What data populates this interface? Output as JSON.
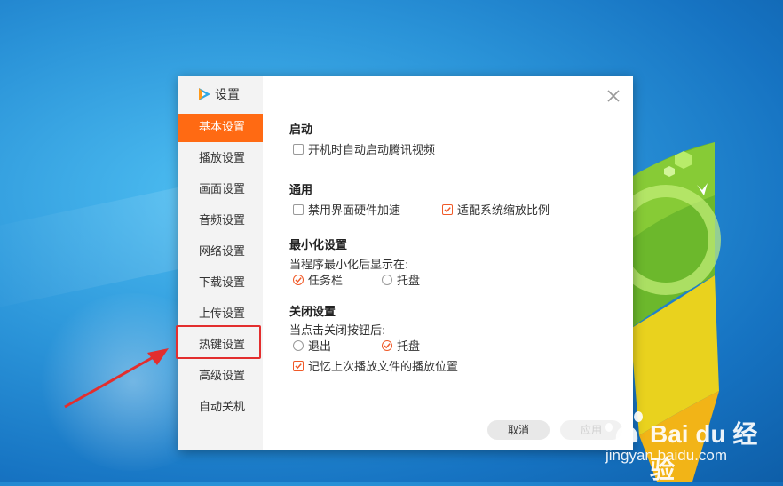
{
  "dialog": {
    "title": "设置",
    "nav": [
      {
        "label": "基本设置",
        "active": true
      },
      {
        "label": "播放设置"
      },
      {
        "label": "画面设置"
      },
      {
        "label": "音频设置"
      },
      {
        "label": "网络设置"
      },
      {
        "label": "下载设置"
      },
      {
        "label": "上传设置"
      },
      {
        "label": "热键设置"
      },
      {
        "label": "高级设置"
      },
      {
        "label": "自动关机"
      }
    ],
    "sections": {
      "startup": {
        "title": "启动",
        "autostart_label": "开机时自动启动腾讯视频",
        "autostart_checked": false
      },
      "general": {
        "title": "通用",
        "disable_hw_label": "禁用界面硬件加速",
        "disable_hw_checked": false,
        "adapt_scale_label": "适配系统缩放比例",
        "adapt_scale_checked": true
      },
      "minimize": {
        "title": "最小化设置",
        "desc": "当程序最小化后显示在:",
        "taskbar_label": "任务栏",
        "tray_label": "托盘",
        "selected": "任务栏"
      },
      "close": {
        "title": "关闭设置",
        "desc": "当点击关闭按钮后:",
        "exit_label": "退出",
        "tray_label": "托盘",
        "selected": "托盘",
        "remember_label": "记忆上次播放文件的播放位置",
        "remember_checked": true
      }
    },
    "buttons": {
      "cancel": "取消",
      "apply": "应用"
    }
  },
  "watermark": {
    "brand": "Bai du 经验",
    "url": "jingyan.baidu.com"
  },
  "colors": {
    "accent": "#ff6a13",
    "check": "#f05a28",
    "annotation": "#e32e2e"
  }
}
